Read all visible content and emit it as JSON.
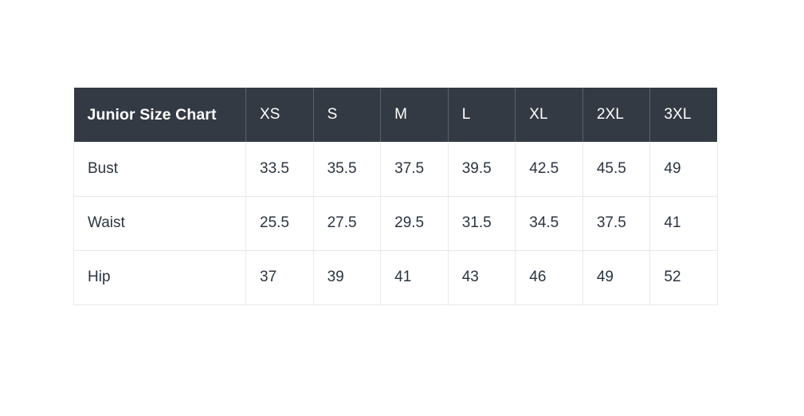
{
  "chart_data": {
    "type": "table",
    "title": "Junior Size Chart",
    "columns": [
      "Junior Size Chart",
      "XS",
      "S",
      "M",
      "L",
      "XL",
      "2XL",
      "3XL"
    ],
    "size_labels": [
      "XS",
      "S",
      "M",
      "L",
      "XL",
      "2XL",
      "3XL"
    ],
    "row_labels": [
      "Bust",
      "Waist",
      "Hip"
    ],
    "rows": [
      {
        "label": "Bust",
        "values": [
          "33.5",
          "35.5",
          "37.5",
          "39.5",
          "42.5",
          "45.5",
          "49"
        ]
      },
      {
        "label": "Waist",
        "values": [
          "25.5",
          "27.5",
          "29.5",
          "31.5",
          "34.5",
          "37.5",
          "41"
        ]
      },
      {
        "label": "Hip",
        "values": [
          "37",
          "39",
          "41",
          "43",
          "46",
          "49",
          "52"
        ]
      }
    ],
    "colors": {
      "header_background": "#343a44",
      "header_text": "#ffffff",
      "body_text": "#2b3440",
      "grid_line": "#e8e8e8",
      "page_background": "#ffffff"
    }
  }
}
